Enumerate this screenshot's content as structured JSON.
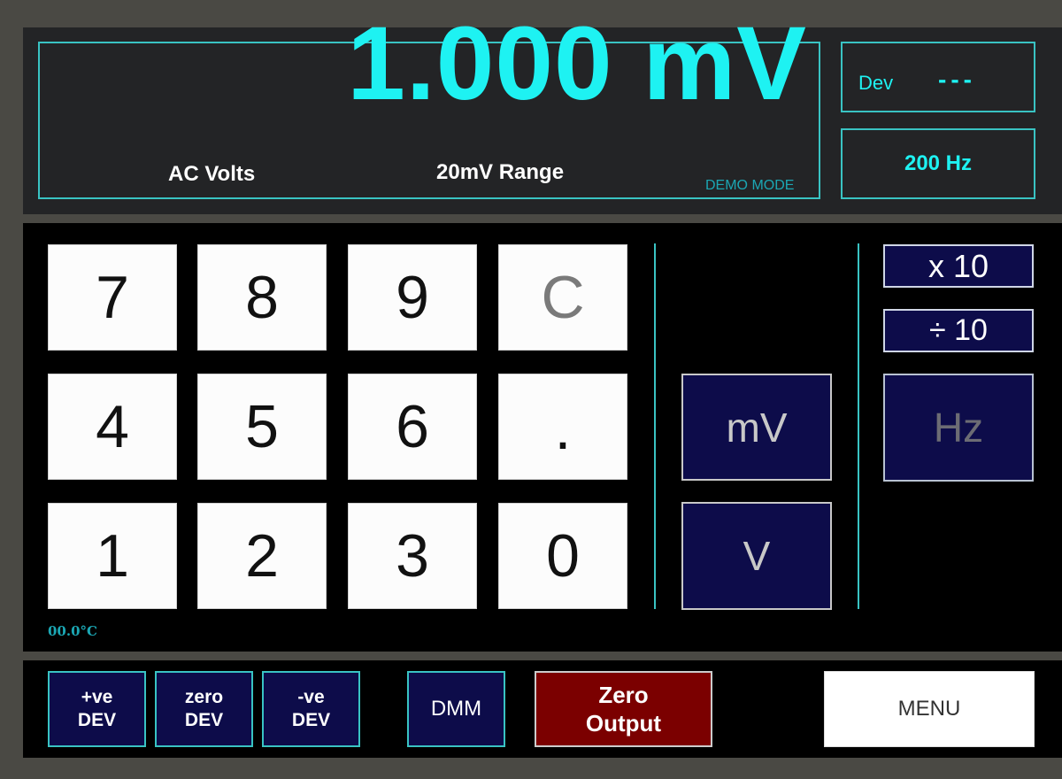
{
  "display": {
    "reading": "1.000 mV",
    "function": "AC Volts",
    "range": "20mV Range",
    "mode": "DEMO MODE",
    "dev_label": "Dev",
    "dev_value": "---",
    "frequency": "200 Hz",
    "temperature": "00.0°C"
  },
  "keypad": {
    "keys": [
      "7",
      "8",
      "9",
      "C",
      "4",
      "5",
      "6",
      ".",
      "1",
      "2",
      "3",
      "0"
    ]
  },
  "units": {
    "mv": "mV",
    "v": "V",
    "x10": "x 10",
    "div10": "÷ 10",
    "hz": "Hz"
  },
  "bottom": {
    "pos_dev": [
      "+ve",
      "DEV"
    ],
    "zero_dev": [
      "zero",
      "DEV"
    ],
    "neg_dev": [
      "-ve",
      "DEV"
    ],
    "dmm": "DMM",
    "zero_output": [
      "Zero",
      "Output"
    ],
    "menu": "MENU"
  },
  "colors": {
    "accent": "#1ef2f2",
    "button_navy": "#0d0c4a",
    "zero_output_red": "#7b0000"
  }
}
